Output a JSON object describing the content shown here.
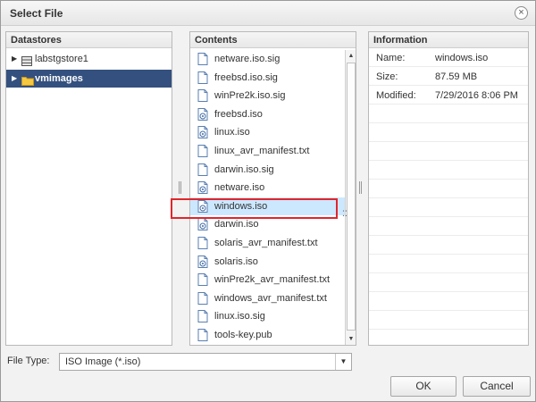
{
  "dialog": {
    "title": "Select File",
    "close_glyph": "×"
  },
  "datastores": {
    "header": "Datastores",
    "items": [
      {
        "label": "labstgstore1",
        "icon": "datastore-icon",
        "expanded": false,
        "selected": false
      },
      {
        "label": "vmimages",
        "icon": "folder-icon",
        "expanded": false,
        "selected": true
      }
    ]
  },
  "contents": {
    "header": "Contents",
    "items": [
      {
        "label": "netware.iso.sig",
        "icon": "file-icon"
      },
      {
        "label": "freebsd.iso.sig",
        "icon": "file-icon"
      },
      {
        "label": "winPre2k.iso.sig",
        "icon": "file-icon"
      },
      {
        "label": "freebsd.iso",
        "icon": "iso-file-icon"
      },
      {
        "label": "linux.iso",
        "icon": "iso-file-icon"
      },
      {
        "label": "linux_avr_manifest.txt",
        "icon": "file-icon"
      },
      {
        "label": "darwin.iso.sig",
        "icon": "file-icon"
      },
      {
        "label": "netware.iso",
        "icon": "iso-file-icon"
      },
      {
        "label": "windows.iso",
        "icon": "iso-file-icon",
        "selected": true
      },
      {
        "label": "darwin.iso",
        "icon": "iso-file-icon"
      },
      {
        "label": "solaris_avr_manifest.txt",
        "icon": "file-icon"
      },
      {
        "label": "solaris.iso",
        "icon": "iso-file-icon"
      },
      {
        "label": "winPre2k_avr_manifest.txt",
        "icon": "file-icon"
      },
      {
        "label": "windows_avr_manifest.txt",
        "icon": "file-icon"
      },
      {
        "label": "linux.iso.sig",
        "icon": "file-icon"
      },
      {
        "label": "tools-key.pub",
        "icon": "file-icon"
      }
    ]
  },
  "information": {
    "header": "Information",
    "rows": [
      {
        "key": "Name:",
        "value": "windows.iso"
      },
      {
        "key": "Size:",
        "value": "87.59 MB"
      },
      {
        "key": "Modified:",
        "value": "7/29/2016 8:06 PM"
      }
    ]
  },
  "file_type": {
    "label": "File Type:",
    "value": "ISO Image (*.iso)"
  },
  "buttons": {
    "ok": "OK",
    "cancel": "Cancel"
  },
  "colors": {
    "selection_dark": "#34507e",
    "selection_light": "#cce8ff",
    "highlight": "#e0262c"
  }
}
